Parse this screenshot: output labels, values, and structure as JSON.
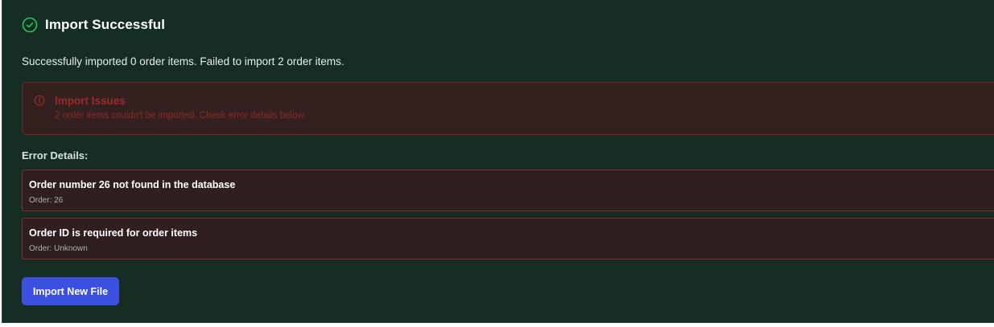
{
  "header": {
    "icon": "check-circle-icon",
    "title": "Import Successful"
  },
  "summary": "Successfully imported 0 order items. Failed to import 2 order items.",
  "issues": {
    "icon": "alert-circle-icon",
    "title": "Import Issues",
    "message": "2 order items couldn't be imported. Check error details below."
  },
  "errors": {
    "heading": "Error Details:",
    "items": [
      {
        "message": "Order number 26 not found in the database",
        "order": "Order: 26"
      },
      {
        "message": "Order ID is required for order items",
        "order": "Order: Unknown"
      }
    ]
  },
  "actions": {
    "import_new_label": "Import New File"
  },
  "colors": {
    "background": "#162d24",
    "success": "#22c55e",
    "error_border": "#8a2b2b",
    "error_text": "#9b2a2a",
    "primary_button": "#3b4fe0"
  }
}
